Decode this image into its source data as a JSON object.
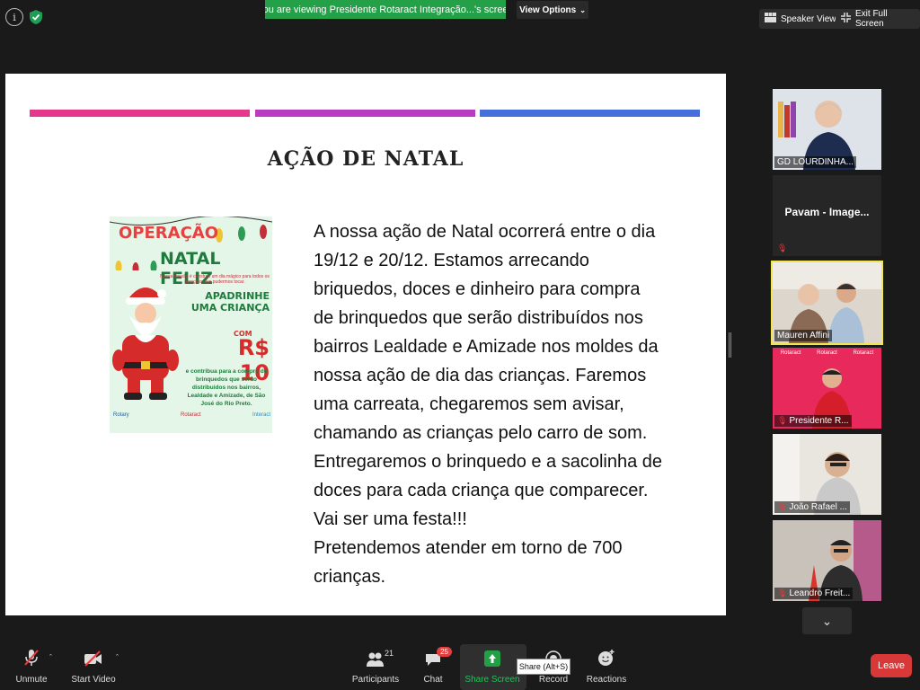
{
  "top": {
    "banner": "You are viewing Presidente Rotaract Integração...'s screen",
    "view_options": "View Options",
    "speaker_view": "Speaker View",
    "exit_full_screen": "Exit Full Screen"
  },
  "slide": {
    "title": "AÇÃO DE NATAL",
    "bar_colors": [
      "#e5378c",
      "#b83bc0",
      "#4570db"
    ],
    "paragraphs": [
      "A nossa ação de Natal ocorrerá entre o dia 19/12 e 20/12. Estamos arrecando briquedos, doces e dinheiro para compra de brinquedos que serão distribuídos nos bairros Lealdade e Amizade nos moldes da nossa ação de dia das crianças. Faremos uma carreata, chegaremos sem avisar, chamando as crianças pelo carro de som.",
      "Entregaremos o brinquedo e a sacolinha de doces para cada criança que comparecer. Vai ser uma festa!!!",
      "Pretendemos atender em torno de 700 crianças."
    ],
    "poster": {
      "line1": "OPERAÇÃO",
      "line2": "NATAL FELIZ",
      "mission": "Nossa missão é construir um dia mágico para todos os corações que pudermos tocar.",
      "apadrinhe1": "APADRINHE",
      "apadrinhe2": "UMA CRIANÇA",
      "com": "COM",
      "price": "R$ 10",
      "body": "e contribua para a compra de brinquedos que serão distribuidos nos bairros, Lealdade e Amizade, de São José do Rio Preto.",
      "logos": [
        "Rotary",
        "Rotaract",
        "Interact"
      ]
    }
  },
  "participants": [
    {
      "name": "GD LOURDINHA...",
      "muted": false,
      "video": true
    },
    {
      "name": "Pavam - Image...",
      "muted": true,
      "video": false
    },
    {
      "name": "Mauren Affini",
      "muted": false,
      "video": true,
      "active": true
    },
    {
      "name": "Presidente R...",
      "muted": true,
      "video": true
    },
    {
      "name": "João Rafael ...",
      "muted": true,
      "video": true
    },
    {
      "name": "Leandro Freit...",
      "muted": true,
      "video": true
    }
  ],
  "toolbar": {
    "unmute": "Unmute",
    "start_video": "Start Video",
    "participants": "Participants",
    "participants_count": "21",
    "chat": "Chat",
    "chat_badge": "25",
    "share_screen": "Share Screen",
    "record": "Record",
    "reactions": "Reactions",
    "leave": "Leave",
    "share_tooltip": "Share (Alt+S)"
  },
  "colors": {
    "banner_green": "#24a148",
    "active_border": "#f2e64a",
    "leave_red": "#d93838",
    "share_green": "#23a046"
  }
}
